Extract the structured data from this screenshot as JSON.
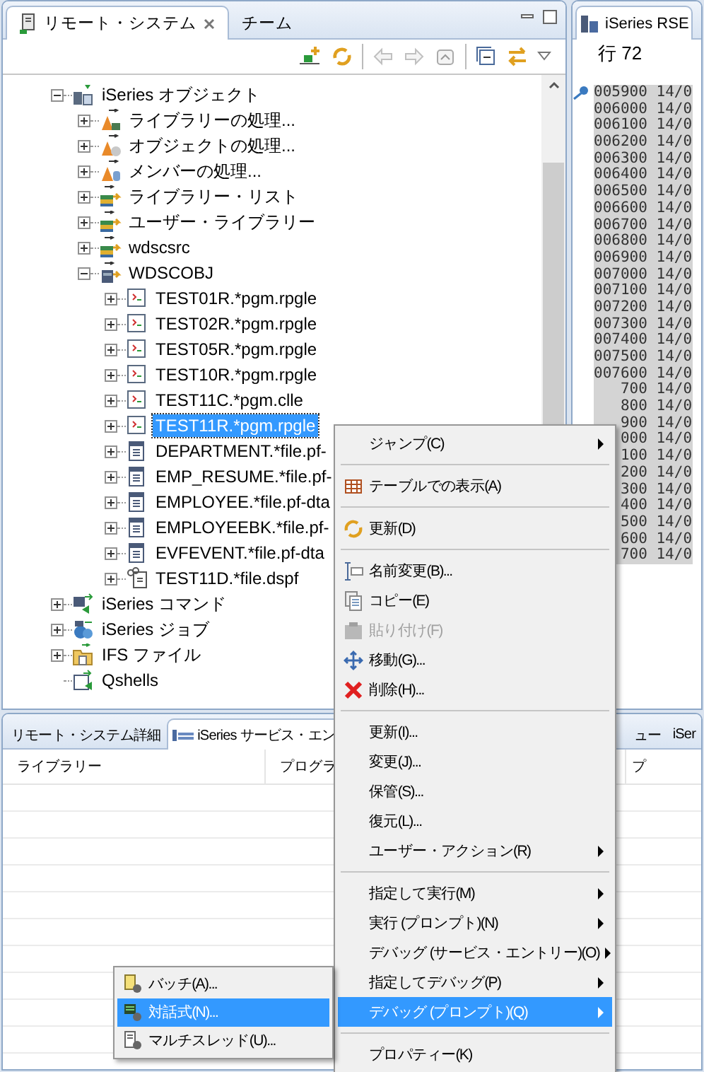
{
  "left_view": {
    "tabs": [
      {
        "label": "リモート・システム",
        "selected": true,
        "closable": true
      },
      {
        "label": "チーム",
        "selected": false,
        "closable": false
      }
    ],
    "tree": [
      {
        "label": "iSeries オブジェクト",
        "kind": "objects",
        "expanded": true,
        "selected": false,
        "children": [
          {
            "label": "ライブラリーの処理...",
            "kind": "library_filter",
            "expanded": false,
            "selected": false
          },
          {
            "label": "オブジェクトの処理...",
            "kind": "object_filter",
            "expanded": false,
            "selected": false
          },
          {
            "label": "メンバーの処理...",
            "kind": "member_filter",
            "expanded": false,
            "selected": false
          },
          {
            "label": "ライブラリー・リスト",
            "kind": "library_list",
            "expanded": false,
            "selected": false
          },
          {
            "label": "ユーザー・ライブラリー",
            "kind": "library_list",
            "expanded": false,
            "selected": false
          },
          {
            "label": "wdscsrc",
            "kind": "library_list",
            "expanded": false,
            "selected": false
          },
          {
            "label": "WDSCOBJ",
            "kind": "library",
            "expanded": true,
            "selected": false,
            "children": [
              {
                "label": "TEST01R.*pgm.rpgle",
                "kind": "program",
                "expanded": false,
                "selected": false
              },
              {
                "label": "TEST02R.*pgm.rpgle",
                "kind": "program",
                "expanded": false,
                "selected": false
              },
              {
                "label": "TEST05R.*pgm.rpgle",
                "kind": "program",
                "expanded": false,
                "selected": false
              },
              {
                "label": "TEST10R.*pgm.rpgle",
                "kind": "program",
                "expanded": false,
                "selected": false
              },
              {
                "label": "TEST11C.*pgm.clle",
                "kind": "program",
                "expanded": false,
                "selected": false
              },
              {
                "label": "TEST11R.*pgm.rpgle",
                "kind": "program",
                "expanded": false,
                "selected": true
              },
              {
                "label": "DEPARTMENT.*file.pf-",
                "kind": "file",
                "expanded": false,
                "selected": false
              },
              {
                "label": "EMP_RESUME.*file.pf-",
                "kind": "file",
                "expanded": false,
                "selected": false
              },
              {
                "label": "EMPLOYEE.*file.pf-dta",
                "kind": "file",
                "expanded": false,
                "selected": false
              },
              {
                "label": "EMPLOYEEBK.*file.pf-",
                "kind": "file",
                "expanded": false,
                "selected": false
              },
              {
                "label": "EVFEVENT.*file.pf-dta",
                "kind": "file",
                "expanded": false,
                "selected": false
              },
              {
                "label": "TEST11D.*file.dspf",
                "kind": "display_file",
                "expanded": false,
                "selected": false
              }
            ]
          }
        ]
      },
      {
        "label": "iSeries コマンド",
        "kind": "commands",
        "expanded": false,
        "selected": false
      },
      {
        "label": "iSeries ジョブ",
        "kind": "jobs",
        "expanded": false,
        "selected": false
      },
      {
        "label": "IFS ファイル",
        "kind": "ifs",
        "expanded": false,
        "selected": false
      },
      {
        "label": "Qshells",
        "kind": "shell",
        "selected": false
      }
    ]
  },
  "editor": {
    "tab": "iSeries RSE",
    "position": "行 72",
    "lines": [
      {
        "text": "005900 14/0",
        "marker": true
      },
      {
        "text": "006000 14/0",
        "marker": false
      },
      {
        "text": "006100 14/0",
        "marker": false
      },
      {
        "text": "006200 14/0",
        "marker": false
      },
      {
        "text": "006300 14/0",
        "marker": false
      },
      {
        "text": "006400 14/0",
        "marker": false
      },
      {
        "text": "006500 14/0",
        "marker": false
      },
      {
        "text": "006600 14/0",
        "marker": false
      },
      {
        "text": "006700 14/0",
        "marker": false
      },
      {
        "text": "006800 14/0",
        "marker": false
      },
      {
        "text": "006900 14/0",
        "marker": false
      },
      {
        "text": "007000 14/0",
        "marker": false
      },
      {
        "text": "007100 14/0",
        "marker": false
      },
      {
        "text": "007200 14/0",
        "marker": false
      },
      {
        "text": "007300 14/0",
        "marker": false
      },
      {
        "text": "007400 14/0",
        "marker": false
      },
      {
        "text": "007500 14/0",
        "marker": false
      },
      {
        "text": "007600 14/0",
        "marker": false
      },
      {
        "text": "700 14/0",
        "marker": false
      },
      {
        "text": "800 14/0",
        "marker": false
      },
      {
        "text": "900 14/0",
        "marker": false
      },
      {
        "text": "000 14/0"
      },
      {
        "text": "100 14/0"
      },
      {
        "text": "200 14/0"
      },
      {
        "text": "300 14/0"
      },
      {
        "text": "400 14/0"
      },
      {
        "text": "500 14/0"
      },
      {
        "text": "600 14/0"
      },
      {
        "text": "700 14/0"
      }
    ]
  },
  "bottom_view": {
    "tabs": [
      {
        "label": "リモート・システム詳細",
        "selected": false
      },
      {
        "label": "iSeries サービス・エン",
        "selected": true
      },
      {
        "label": "ュー",
        "selected": false
      },
      {
        "label": "iSer",
        "selected": false
      }
    ],
    "columns": [
      "ライブラリー",
      "プログラ",
      "プ"
    ]
  },
  "context_menu": [
    {
      "kind": "item",
      "label": "ジャンプ(C)",
      "submenu": true,
      "disabled": false,
      "selected": false
    },
    {
      "kind": "separator"
    },
    {
      "kind": "item",
      "label": "テーブルでの表示(A)",
      "submenu": false,
      "disabled": false,
      "selected": false
    },
    {
      "kind": "separator"
    },
    {
      "kind": "item",
      "label": "更新(D)",
      "submenu": false,
      "disabled": false,
      "selected": false
    },
    {
      "kind": "separator"
    },
    {
      "kind": "item",
      "label": "名前変更(B)...",
      "submenu": false,
      "disabled": false,
      "selected": false
    },
    {
      "kind": "item",
      "label": "コピー(E)",
      "submenu": false,
      "disabled": false,
      "selected": false
    },
    {
      "kind": "item",
      "label": "貼り付け(F)",
      "submenu": false,
      "disabled": true,
      "selected": false
    },
    {
      "kind": "item",
      "label": "移動(G)...",
      "submenu": false,
      "disabled": false,
      "selected": false
    },
    {
      "kind": "item",
      "label": "削除(H)...",
      "submenu": false,
      "disabled": false,
      "selected": false
    },
    {
      "kind": "separator"
    },
    {
      "kind": "item",
      "label": "更新(I)...",
      "submenu": false,
      "disabled": false,
      "selected": false
    },
    {
      "kind": "item",
      "label": "変更(J)...",
      "submenu": false,
      "disabled": false,
      "selected": false
    },
    {
      "kind": "item",
      "label": "保管(S)...",
      "submenu": false,
      "disabled": false,
      "selected": false
    },
    {
      "kind": "item",
      "label": "復元(L)...",
      "submenu": false,
      "disabled": false,
      "selected": false
    },
    {
      "kind": "item",
      "label": "ユーザー・アクション(R)",
      "submenu": true,
      "disabled": false,
      "selected": false
    },
    {
      "kind": "separator"
    },
    {
      "kind": "item",
      "label": "指定して実行(M)",
      "submenu": true,
      "disabled": false,
      "selected": false
    },
    {
      "kind": "item",
      "label": "実行 (プロンプト)(N)",
      "submenu": true,
      "disabled": false,
      "selected": false
    },
    {
      "kind": "item",
      "label": "デバッグ (サービス・エントリー)(O)",
      "submenu": true,
      "disabled": false,
      "selected": false
    },
    {
      "kind": "item",
      "label": "指定してデバッグ(P)",
      "submenu": true,
      "disabled": false,
      "selected": false
    },
    {
      "kind": "item",
      "label": "デバッグ (プロンプト)(Q)",
      "submenu": true,
      "disabled": false,
      "selected": true
    },
    {
      "kind": "separator"
    },
    {
      "kind": "item",
      "label": "プロパティー(K)",
      "submenu": false,
      "disabled": false,
      "selected": false
    }
  ],
  "submenu": [
    {
      "label": "バッチ(A)...",
      "selected": false
    },
    {
      "label": "対話式(N)...",
      "selected": true
    },
    {
      "label": "マルチスレッド(U)...",
      "selected": false
    }
  ]
}
